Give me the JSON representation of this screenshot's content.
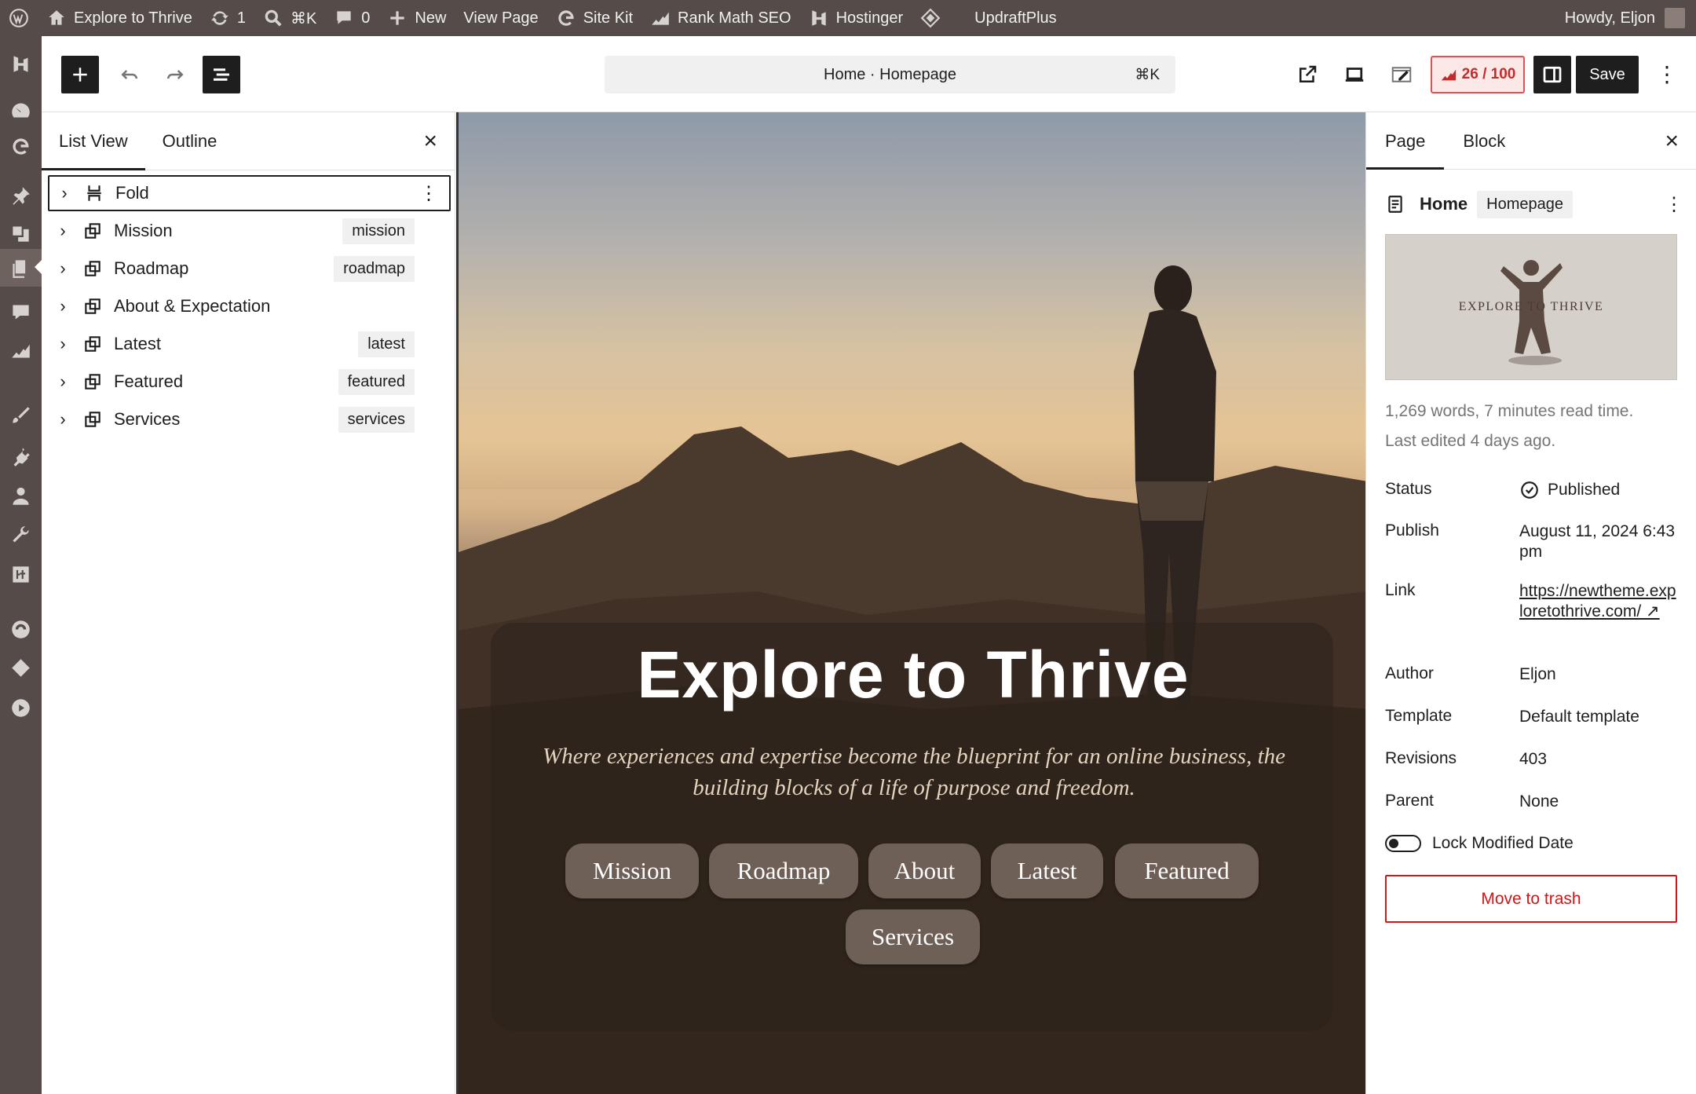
{
  "adminbar": {
    "site_name": "Explore to Thrive",
    "updates_count": "1",
    "search_shortcut": "⌘K",
    "comments_count": "0",
    "new_label": "New",
    "view_page_label": "View Page",
    "sitekit_label": "Site Kit",
    "rankmath_label": "Rank Math SEO",
    "hostinger_label": "Hostinger",
    "updraft_label": "UpdraftPlus",
    "howdy": "Howdy, Eljon"
  },
  "header": {
    "command_title": "Home · Homepage",
    "command_shortcut": "⌘K",
    "score": "26 / 100",
    "save_label": "Save"
  },
  "listview": {
    "tabs": [
      "List View",
      "Outline"
    ],
    "items": [
      {
        "label": "Fold",
        "badge": ""
      },
      {
        "label": "Mission",
        "badge": "mission"
      },
      {
        "label": "Roadmap",
        "badge": "roadmap"
      },
      {
        "label": "About & Expectation",
        "badge": ""
      },
      {
        "label": "Latest",
        "badge": "latest"
      },
      {
        "label": "Featured",
        "badge": "featured"
      },
      {
        "label": "Services",
        "badge": "services"
      }
    ]
  },
  "canvas": {
    "title": "Explore to Thrive",
    "subtitle": "Where experiences and expertise become the blueprint for an online business, the building blocks of a life of purpose and freedom.",
    "buttons": [
      "Mission",
      "Roadmap",
      "About",
      "Latest",
      "Featured",
      "Services"
    ]
  },
  "sidebar": {
    "tabs": [
      "Page",
      "Block"
    ],
    "doc_title": "Home",
    "doc_slug": "Homepage",
    "featured_image_text": "EXPLORE TO THRIVE",
    "meta_words": "1,269 words, 7 minutes read time.",
    "meta_edited": "Last edited 4 days ago.",
    "rows": {
      "status": {
        "k": "Status",
        "v": "Published"
      },
      "publish": {
        "k": "Publish",
        "v": "August 11, 2024 6:43 pm"
      },
      "link": {
        "k": "Link",
        "v": "https://newtheme.exploretothrive.com/ ↗"
      },
      "author": {
        "k": "Author",
        "v": "Eljon"
      },
      "template": {
        "k": "Template",
        "v": "Default template"
      },
      "revisions": {
        "k": "Revisions",
        "v": "403"
      },
      "parent": {
        "k": "Parent",
        "v": "None"
      }
    },
    "lock_label": "Lock Modified Date",
    "trash_label": "Move to trash"
  },
  "colors": {
    "admin_bar": "#554c49",
    "accent_dark": "#1e1e1e",
    "score_red": "#c42b2b",
    "trash_red": "#cc1818",
    "pill_brown": "#6e5f57"
  }
}
